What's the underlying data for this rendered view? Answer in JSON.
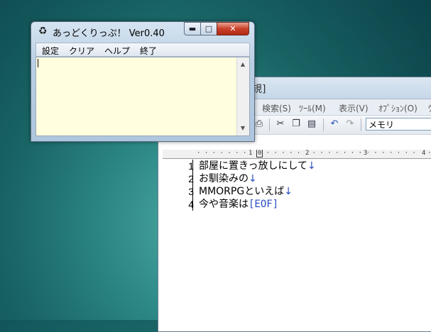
{
  "editor": {
    "title_fragment": "規]",
    "menu": [
      "検索(S)",
      "ﾂｰﾙ(M)",
      "表示(V)",
      "ｵﾌﾟｼｮﾝ(O)",
      "ｳ"
    ],
    "font_name": "メモリ",
    "ruler_marks": [
      "1",
      "0",
      "2",
      "3",
      "4"
    ],
    "lines": [
      {
        "num": "1",
        "text": "部屋に置きっ放しにして",
        "mark": "↓"
      },
      {
        "num": "2",
        "text": "お馴染みの",
        "mark": "↓"
      },
      {
        "num": "3",
        "text": "MMORPGといえば",
        "mark": "↓"
      },
      {
        "num": "4",
        "text": "今や音楽は",
        "mark": "[EOF]"
      }
    ]
  },
  "clip": {
    "title": "あっどくりっぷ！ Ver0.40",
    "menu": {
      "settings": "設定",
      "clear": "クリア",
      "help": "ヘルプ",
      "exit": "終了"
    },
    "body_text": ""
  },
  "colors": {
    "clip_body_bg": "#ffffe0",
    "desktop": "#2d8a86",
    "close_button": "#c9412a"
  }
}
